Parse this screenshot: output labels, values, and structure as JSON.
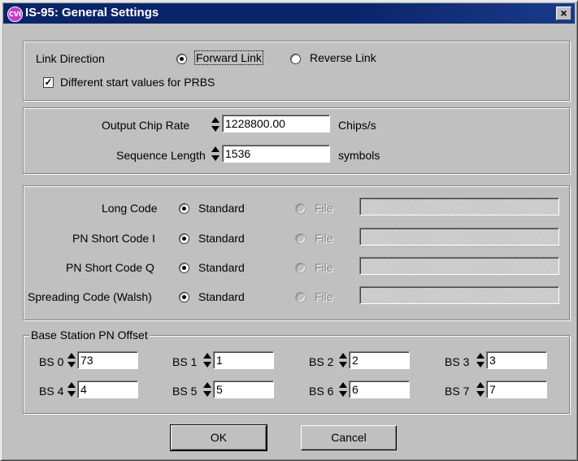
{
  "window": {
    "title": "IS-95: General Settings",
    "icon_text": "CVI",
    "close_label": "×"
  },
  "link_group": {
    "link_direction_label": "Link Direction",
    "forward_label": "Forward Link",
    "reverse_label": "Reverse Link",
    "selected": "forward",
    "prbs_label": "Different start values for PRBS",
    "prbs_checked": true,
    "check_glyph": "✓"
  },
  "rate_group": {
    "chip_rate_label": "Output Chip Rate",
    "chip_rate_value": "1228800.00",
    "chip_rate_unit": "Chips/s",
    "seq_len_label": "Sequence Length",
    "seq_len_value": "1536",
    "seq_len_unit": "symbols"
  },
  "codes_group": {
    "standard_label": "Standard",
    "file_label": "File",
    "rows": [
      {
        "label": "Long Code"
      },
      {
        "label": "PN Short Code I"
      },
      {
        "label": "PN Short Code Q"
      },
      {
        "label": "Spreading Code (Walsh)"
      }
    ]
  },
  "bs_group": {
    "title": "Base Station PN Offset",
    "stations": [
      {
        "label": "BS 0",
        "value": "73"
      },
      {
        "label": "BS 1",
        "value": "1"
      },
      {
        "label": "BS 2",
        "value": "2"
      },
      {
        "label": "BS 3",
        "value": "3"
      },
      {
        "label": "BS 4",
        "value": "4"
      },
      {
        "label": "BS 5",
        "value": "5"
      },
      {
        "label": "BS 6",
        "value": "6"
      },
      {
        "label": "BS 7",
        "value": "7"
      }
    ]
  },
  "buttons": {
    "ok_label": "OK",
    "cancel_label": "Cancel"
  }
}
